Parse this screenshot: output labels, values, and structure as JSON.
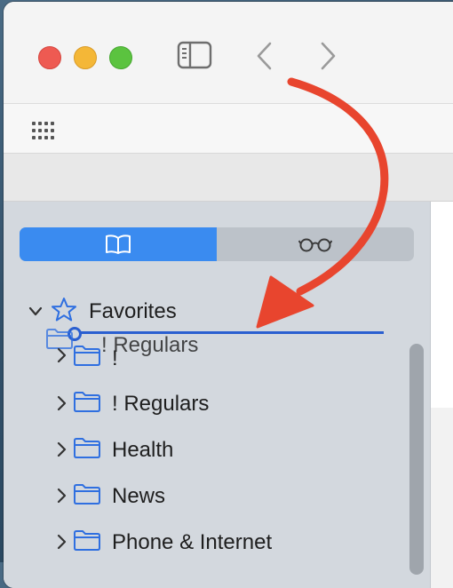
{
  "toolbar": {
    "traffic_lights": [
      {
        "name": "close",
        "color": "#ee5a52"
      },
      {
        "name": "minimize",
        "color": "#f4b737"
      },
      {
        "name": "zoom",
        "color": "#5bc33f"
      }
    ],
    "icons": [
      "sidebar-toggle-icon",
      "back-chevron-icon",
      "forward-chevron-icon"
    ]
  },
  "favorites_bar": {
    "icons": [
      "grid-icon"
    ]
  },
  "sidebar": {
    "segmented": {
      "bookmarks_icon": "book-icon",
      "reading_list_icon": "glasses-icon",
      "selected": "bookmarks",
      "accent_color": "#3a8bf0"
    },
    "favorites": {
      "label": "Favorites",
      "expanded": true
    },
    "drag": {
      "dragged_label": "! Regulars"
    },
    "folders": [
      {
        "label": "!"
      },
      {
        "label": "! Regulars"
      },
      {
        "label": "Health"
      },
      {
        "label": "News"
      },
      {
        "label": "Phone & Internet"
      }
    ]
  },
  "annotation": {
    "arrow_color": "#e8452e"
  }
}
